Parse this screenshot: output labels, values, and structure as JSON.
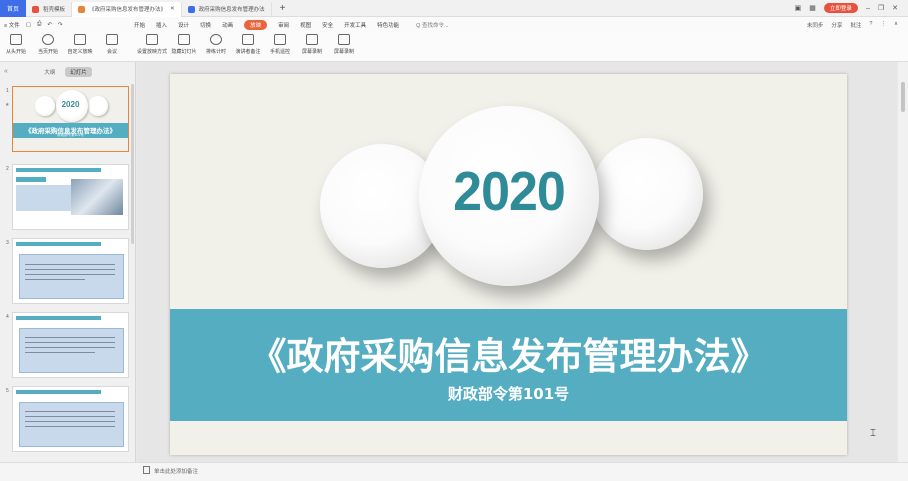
{
  "tabbar": {
    "home_label": "首页",
    "tabs": [
      {
        "label": "稻壳模板",
        "color": "#e8513d"
      },
      {
        "label": "《政府采购信息发布管理办法》",
        "color": "#e8853d"
      },
      {
        "label": "政府采购信息发布管理办法",
        "color": "#3d6ee8"
      }
    ],
    "add_label": "+",
    "login_label": "立即登录"
  },
  "menubar": {
    "file_label": "≡ 文件",
    "items": [
      "开始",
      "插入",
      "设计",
      "切换",
      "动画",
      "放映",
      "审阅",
      "视图",
      "安全",
      "开发工具",
      "特色功能"
    ],
    "active_item": "放映",
    "search_label": "Q 查找命令...",
    "right_items": [
      "未同步",
      "分享",
      "批注"
    ]
  },
  "ribbon": {
    "buttons": [
      "从头开始",
      "当页开始",
      "自定义放映",
      "会议",
      "设置放映方式",
      "隐藏幻灯片",
      "排练计时",
      "演讲者备注",
      "手机遥控",
      "屏幕录制",
      "屏幕录制"
    ]
  },
  "left_panel": {
    "tabs": [
      "大纲",
      "幻灯片"
    ],
    "active_tab": "幻灯片",
    "slide_numbers": [
      "1",
      "2",
      "3",
      "4",
      "5"
    ],
    "add_label": "+"
  },
  "slide": {
    "year": "2020",
    "title": "《政府采购信息发布管理办法》",
    "subtitle": "财政部令第101号",
    "accent_color": "#55adc2",
    "year_color": "#2e8b97"
  },
  "thumb1": {
    "year": "2020",
    "title": "《政府采购信息发布管理办法》",
    "subtitle": "财政部令第101号"
  },
  "statusbar": {
    "note_placeholder": "单击此处添加备注"
  }
}
